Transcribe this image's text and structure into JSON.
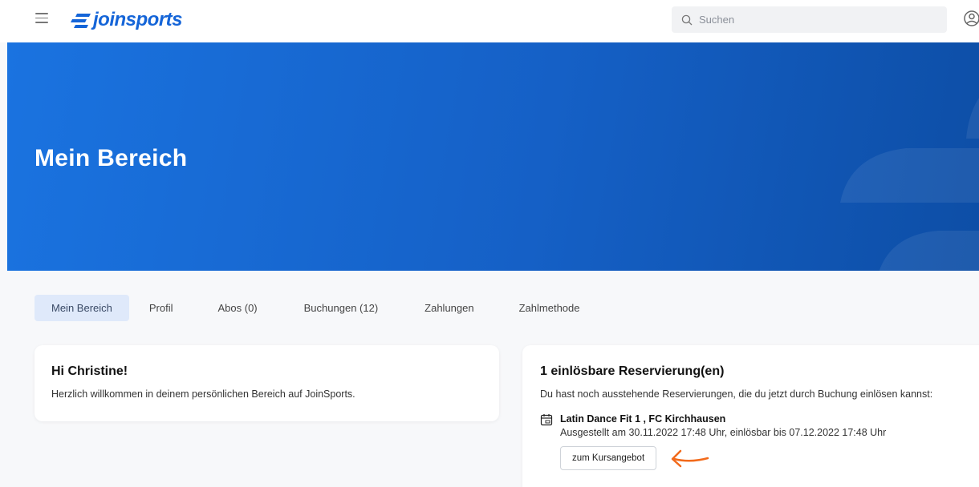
{
  "header": {
    "logo_text": "joinsports",
    "search_placeholder": "Suchen"
  },
  "hero": {
    "title": "Mein Bereich"
  },
  "tabs": [
    {
      "label": "Mein Bereich",
      "active": true
    },
    {
      "label": "Profil",
      "active": false
    },
    {
      "label": "Abos (0)",
      "active": false
    },
    {
      "label": "Buchungen (12)",
      "active": false
    },
    {
      "label": "Zahlungen",
      "active": false
    },
    {
      "label": "Zahlmethode",
      "active": false
    }
  ],
  "welcome": {
    "title": "Hi Christine!",
    "text": "Herzlich willkommen in deinem persönlichen Bereich auf JoinSports."
  },
  "reservations": {
    "title": "1 einlösbare Reservierung(en)",
    "intro": "Du hast noch ausstehende Reservierungen, die du jetzt durch Buchung einlösen kannst:",
    "items": [
      {
        "name": "Latin Dance Fit 1 , FC Kirchhausen",
        "meta": "Ausgestellt am 30.11.2022 17:48 Uhr, einlösbar bis 07.12.2022 17:48 Uhr",
        "button_label": "zum Kursangebot"
      }
    ]
  },
  "colors": {
    "brand": "#1565d8",
    "hero_start": "#1a73e0",
    "hero_end": "#0d4ea6",
    "tab_active_bg": "#dfe9fa",
    "annotation_arrow": "#f26a1b"
  },
  "icons": {
    "menu": "hamburger-menu-icon",
    "search": "search-icon",
    "user": "user-icon",
    "calendar": "calendar-icon",
    "arrow": "arrow-left-annotation-icon"
  }
}
